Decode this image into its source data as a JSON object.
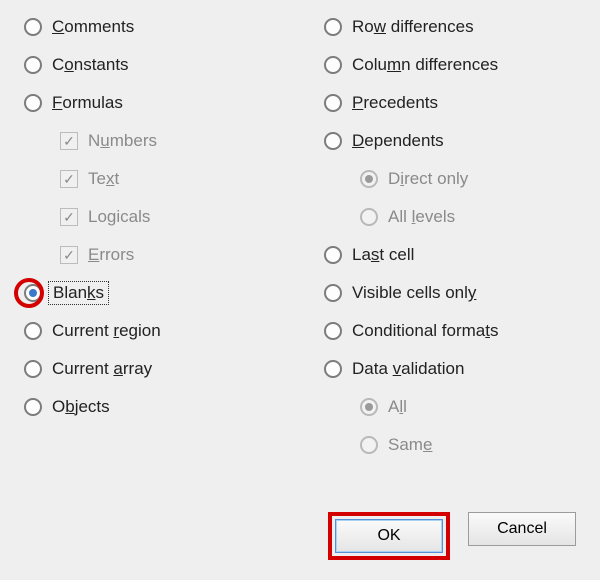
{
  "left": {
    "comments": {
      "pre": "",
      "u": "C",
      "post": "omments"
    },
    "constants": {
      "pre": "C",
      "u": "o",
      "post": "nstants"
    },
    "formulas": {
      "pre": "",
      "u": "F",
      "post": "ormulas"
    },
    "numbers": {
      "pre": "N",
      "u": "u",
      "post": "mbers"
    },
    "text": {
      "pre": "Te",
      "u": "x",
      "post": "t"
    },
    "logicals": {
      "pre": "Lo",
      "u": "g",
      "post": "icals"
    },
    "errors": {
      "pre": "",
      "u": "E",
      "post": "rrors"
    },
    "blanks": {
      "pre": "Blan",
      "u": "k",
      "post": "s"
    },
    "current_region": {
      "pre": "Current ",
      "u": "r",
      "post": "egion"
    },
    "current_array": {
      "pre": "Current ",
      "u": "a",
      "post": "rray"
    },
    "objects": {
      "pre": "O",
      "u": "b",
      "post": "jects"
    }
  },
  "right": {
    "row_diff": {
      "pre": "Ro",
      "u": "w",
      "post": " differences"
    },
    "col_diff": {
      "pre": "Colu",
      "u": "m",
      "post": "n differences"
    },
    "precedents": {
      "pre": "",
      "u": "P",
      "post": "recedents"
    },
    "dependents": {
      "pre": "",
      "u": "D",
      "post": "ependents"
    },
    "direct_only": {
      "pre": "D",
      "u": "i",
      "post": "rect only"
    },
    "all_levels": {
      "pre": "All ",
      "u": "l",
      "post": "evels"
    },
    "last_cell": {
      "pre": "La",
      "u": "s",
      "post": "t cell"
    },
    "visible_cells": {
      "pre": "Visible cells onl",
      "u": "y",
      "post": ""
    },
    "cond_formats": {
      "pre": "Conditional forma",
      "u": "t",
      "post": "s"
    },
    "data_validation": {
      "pre": "Data ",
      "u": "v",
      "post": "alidation"
    },
    "all": {
      "pre": "A",
      "u": "l",
      "post": "l"
    },
    "same": {
      "pre": "Sam",
      "u": "e",
      "post": ""
    }
  },
  "buttons": {
    "ok": "OK",
    "cancel": "Cancel"
  },
  "selection": {
    "selected_option": "blanks",
    "sub_selected_right": "direct_only",
    "sub_selected_validation": "all"
  },
  "annotations": {
    "circled": "blanks",
    "boxed_button": "ok"
  }
}
